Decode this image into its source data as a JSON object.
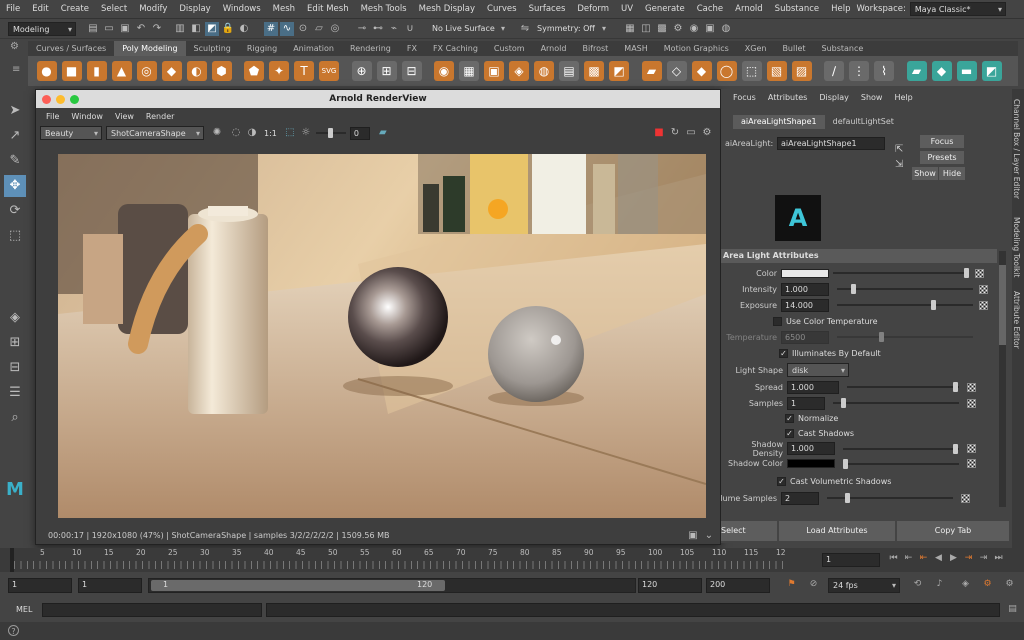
{
  "menubar": {
    "items": [
      "File",
      "Edit",
      "Create",
      "Select",
      "Modify",
      "Display",
      "Windows",
      "Mesh",
      "Edit Mesh",
      "Mesh Tools",
      "Mesh Display",
      "Curves",
      "Surfaces",
      "Deform",
      "UV",
      "Generate",
      "Cache",
      "Arnold",
      "Substance",
      "Help"
    ],
    "workspace_label": "Workspace:",
    "workspace_value": "Maya Classic*"
  },
  "statusline": {
    "mode": "Modeling",
    "live_surface": "No Live Surface",
    "symmetry": "Symmetry: Off"
  },
  "shelf": {
    "tabs": [
      "Curves / Surfaces",
      "Poly Modeling",
      "Sculpting",
      "Rigging",
      "Animation",
      "Rendering",
      "FX",
      "FX Caching",
      "Custom",
      "Arnold",
      "Bifrost",
      "MASH",
      "Motion Graphics",
      "XGen",
      "Bullet",
      "Substance"
    ],
    "active_tab": "Poly Modeling"
  },
  "renderview": {
    "title": "Arnold RenderView",
    "menu": [
      "File",
      "Window",
      "View",
      "Render"
    ],
    "aov": "Beauty",
    "camera": "ShotCameraShape",
    "ratio": "1:1",
    "exposure": "0",
    "status": "00:00:17 | 1920x1080 (47%) | ShotCameraShape | samples 3/2/2/2/2/2 | 1509.56 MB"
  },
  "attr": {
    "menu": [
      "Focus",
      "Attributes",
      "Display",
      "Show",
      "Help"
    ],
    "tabs": [
      "aiAreaLightShape1",
      "defaultLightSet"
    ],
    "node_label": "aiAreaLight:",
    "node_name": "aiAreaLightShape1",
    "btn_focus": "Focus",
    "btn_presets": "Presets",
    "btn_show": "Show",
    "btn_hide": "Hide",
    "section": "Area Light Attributes",
    "color_label": "Color",
    "intensity_label": "Intensity",
    "intensity": "1.000",
    "exposure_label": "Exposure",
    "exposure": "14.000",
    "use_color_temp": "Use Color Temperature",
    "temperature_label": "Temperature",
    "temperature": "6500",
    "illuminates": "Illuminates By Default",
    "light_shape_label": "Light Shape",
    "light_shape": "disk",
    "spread_label": "Spread",
    "spread": "1.000",
    "samples_label": "Samples",
    "samples": "1",
    "normalize": "Normalize",
    "cast_shadows": "Cast Shadows",
    "shadow_density_label": "Shadow Density",
    "shadow_density": "1.000",
    "shadow_color_label": "Shadow Color",
    "cast_vol": "Cast Volumetric Shadows",
    "vol_samples_label": "Volume Samples",
    "vol_samples": "2",
    "btn_select": "Select",
    "btn_load": "Load Attributes",
    "btn_copy": "Copy Tab",
    "colors": {
      "color_swatch": "#e8e8e8",
      "shadow_color": "#000000"
    }
  },
  "sidetabs": [
    "Channel Box / Layer Editor",
    "Modeling Toolkit",
    "Attribute Editor"
  ],
  "timeline": {
    "ticks": [
      "5",
      "10",
      "15",
      "20",
      "25",
      "30",
      "35",
      "40",
      "45",
      "50",
      "55",
      "60",
      "65",
      "70",
      "75",
      "80",
      "85",
      "90",
      "95",
      "100",
      "105",
      "110",
      "115",
      "12"
    ],
    "current_frame": "1"
  },
  "range": {
    "start": "1",
    "anim_start": "1",
    "range_start": "1",
    "range_end": "120",
    "end": "120",
    "anim_end": "200",
    "fps": "24 fps"
  },
  "cmd": {
    "label": "MEL"
  }
}
